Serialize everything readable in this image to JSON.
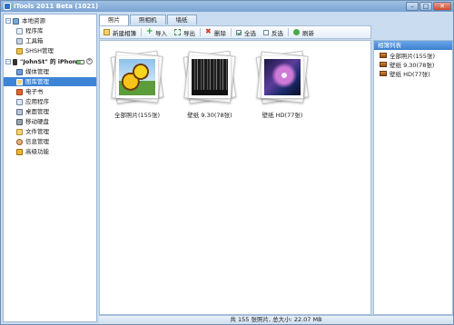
{
  "window": {
    "title": "iTools 2011 Beta (1021)",
    "minimize": "–",
    "maximize": "□",
    "close": "✕"
  },
  "sidebar": {
    "local": {
      "label": "本地资源",
      "items": [
        {
          "label": "程序库"
        },
        {
          "label": "工具箱"
        },
        {
          "label": "SHSH管理"
        }
      ]
    },
    "device": {
      "label": "\"JohnSt\" 的 iPhone",
      "items": [
        {
          "label": "媒体管理"
        },
        {
          "label": "图库管理"
        },
        {
          "label": "电子书"
        },
        {
          "label": "应用程序"
        },
        {
          "label": "桌面管理"
        },
        {
          "label": "移动硬盘"
        },
        {
          "label": "文件管理"
        },
        {
          "label": "信息管理"
        },
        {
          "label": "高级功能"
        }
      ]
    },
    "selected": "图库管理"
  },
  "tabs": [
    {
      "label": "照片"
    },
    {
      "label": "照相机"
    },
    {
      "label": "墙纸"
    }
  ],
  "toolbar": {
    "new_album": "新建相簿",
    "import": "导入",
    "export": "导出",
    "delete": "删除",
    "select_all": "全选",
    "invert": "反选",
    "refresh": "刷新"
  },
  "albums": [
    {
      "label": "全部照片(155张)"
    },
    {
      "label": "壁纸 9.30(78张)"
    },
    {
      "label": "壁纸 HD(77张)"
    }
  ],
  "album_list": {
    "title": "相簿列表",
    "items": [
      {
        "label": "全部照片(155张)"
      },
      {
        "label": "壁纸 9.30(78张)"
      },
      {
        "label": "壁纸 HD(77张)"
      }
    ]
  },
  "status": {
    "text": "共 155 张照片, 总大小: 22.07 MB"
  }
}
